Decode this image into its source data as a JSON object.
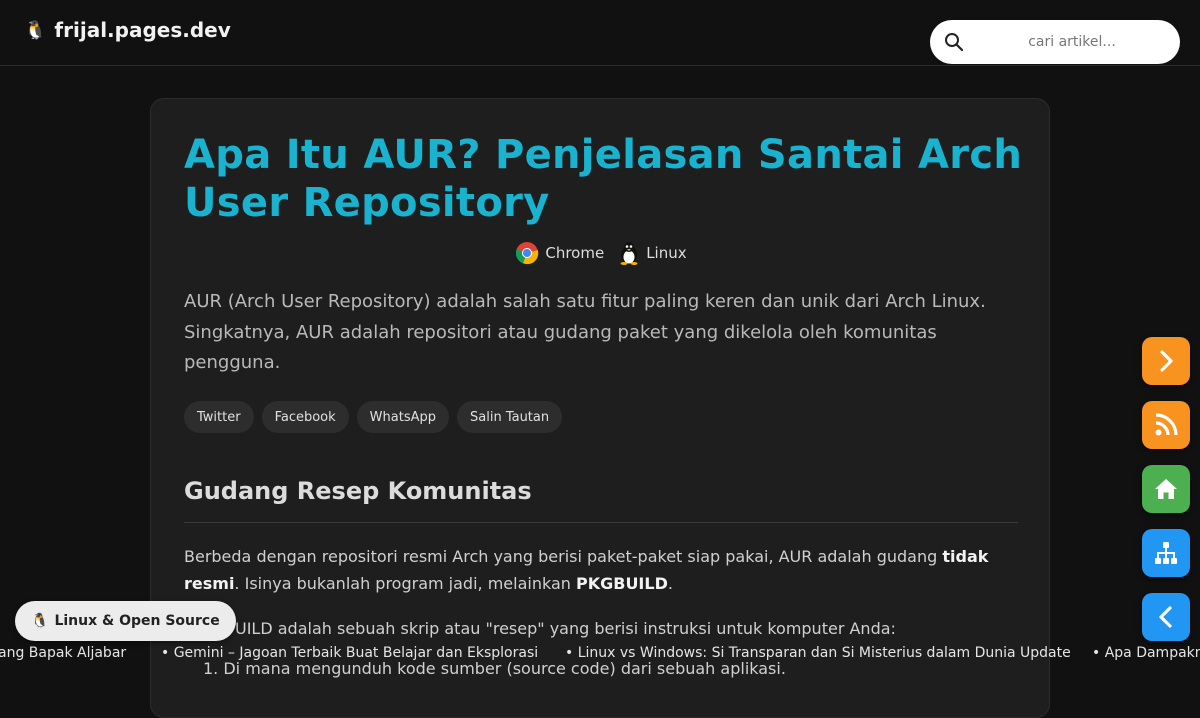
{
  "header": {
    "site_name": "frijal.pages.dev",
    "logo_icon": "tux-icon",
    "search": {
      "placeholder": "cari artikel...",
      "value": "",
      "icon": "search-icon"
    }
  },
  "article": {
    "title": "Apa Itu AUR? Penjelasan Santai Arch User Repository",
    "meta": [
      {
        "label": "Chrome",
        "icon": "chrome-icon"
      },
      {
        "label": "Linux",
        "icon": "tux-icon"
      }
    ],
    "intro": "AUR (Arch User Repository) adalah salah satu fitur paling keren dan unik dari Arch Linux. Singkatnya, AUR adalah repositori atau gudang paket yang dikelola oleh komunitas pengguna.",
    "share_buttons": [
      "Twitter",
      "Facebook",
      "WhatsApp",
      "Salin Tautan"
    ],
    "section_heading": "Gudang Resep Komunitas",
    "para1": {
      "part1": "Berbeda dengan repositori resmi Arch yang berisi paket-paket siap pakai, AUR adalah gudang ",
      "bold1": "tidak resmi",
      "part2": ". Isinya bukanlah program jadi, melainkan ",
      "bold2": "PKGBUILD",
      "part3": "."
    },
    "para2_visible": "UILD adalah sebuah skrip atau \"resep\" yang berisi instruksi untuk komputer Anda:",
    "list_item_1": "1. Di mana mengunduh kode sumber (source code) dari sebuah aplikasi."
  },
  "category_badge": {
    "label": "Linux & Open Source",
    "icon": "tux-icon"
  },
  "ticker": [
    "ang Bapak Aljabar",
    "• Gemini – Jagoan Terbaik Buat Belajar dan Eksplorasi",
    "• Linux vs Windows: Si Transparan dan Si Misterius dalam Dunia Update",
    "• Apa Dampakn"
  ],
  "floating_buttons": [
    {
      "name": "next",
      "icon": "chevron-right-icon",
      "color": "#f7931e"
    },
    {
      "name": "rss",
      "icon": "rss-icon",
      "color": "#f7931e"
    },
    {
      "name": "home",
      "icon": "home-icon",
      "color": "#4caf50"
    },
    {
      "name": "sitemap",
      "icon": "sitemap-icon",
      "color": "#2196f3"
    },
    {
      "name": "back",
      "icon": "chevron-left-icon",
      "color": "#2196f3"
    }
  ],
  "colors": {
    "accent_title": "#1ab3cf",
    "background": "#111111",
    "card": "#1e1e1e"
  }
}
